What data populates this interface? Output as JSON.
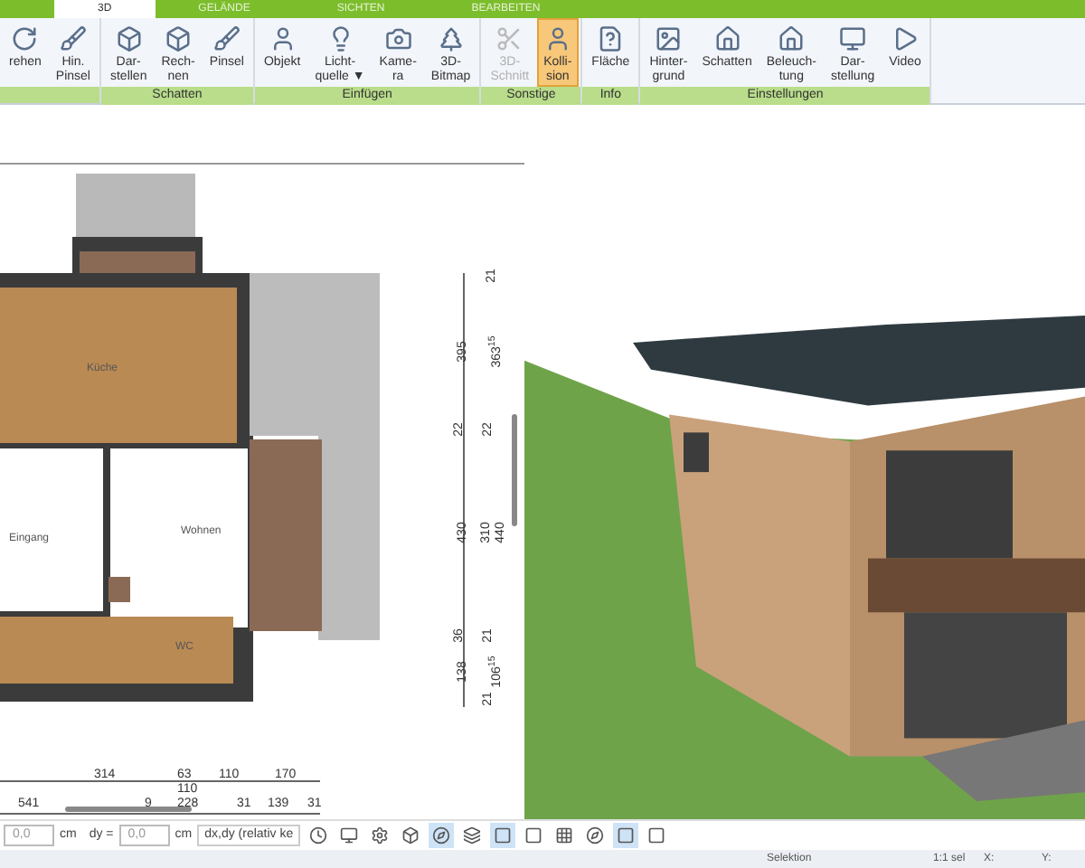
{
  "ribbon_tabs": [
    {
      "label": "3D",
      "selected": true
    },
    {
      "label": "GELÄNDE",
      "selected": false
    },
    {
      "label": "SICHTEN",
      "selected": false
    },
    {
      "label": "BEARBEITEN",
      "selected": false
    }
  ],
  "ribbon_groups": [
    {
      "buttons": [
        {
          "label": "rehen",
          "selected": false,
          "disabled": false
        },
        {
          "label": "Hin.\nPinsel",
          "selected": false,
          "disabled": false
        }
      ]
    },
    {
      "label": "Schatten",
      "buttons": [
        {
          "label": "Dar-\nstellen",
          "selected": false,
          "disabled": false
        },
        {
          "label": "Rech-\nnen",
          "selected": false,
          "disabled": false
        },
        {
          "label": "Pinsel",
          "selected": false,
          "disabled": false
        }
      ]
    },
    {
      "label": "Einfügen",
      "buttons": [
        {
          "label": "Objekt",
          "selected": false,
          "disabled": false
        },
        {
          "label": "Licht-\nquelle ▼",
          "selected": false,
          "disabled": false
        },
        {
          "label": "Kame-\nra",
          "selected": false,
          "disabled": false
        },
        {
          "label": "3D-\nBitmap",
          "selected": false,
          "disabled": false
        }
      ]
    },
    {
      "label": "Sonstige",
      "buttons": [
        {
          "label": "3D-\nSchnitt",
          "selected": false,
          "disabled": true
        },
        {
          "label": "Kolli-\nsion",
          "selected": true,
          "disabled": false
        }
      ]
    },
    {
      "label": "Info",
      "buttons": [
        {
          "label": "Fläche",
          "selected": false,
          "disabled": false
        }
      ]
    },
    {
      "label": "Einstellungen",
      "buttons": [
        {
          "label": "Hinter-\ngrund",
          "selected": false,
          "disabled": false
        },
        {
          "label": "Schatten",
          "selected": false,
          "disabled": false
        },
        {
          "label": "Beleuch-\ntung",
          "selected": false,
          "disabled": false
        },
        {
          "label": "Dar-\nstellung",
          "selected": false,
          "disabled": false
        },
        {
          "label": "Video",
          "selected": false,
          "disabled": false
        }
      ]
    }
  ],
  "floor_plan": {
    "rooms": [
      "Küche",
      "Eingang",
      "Wohnen",
      "WC"
    ],
    "vertical_dimensions": [
      "21",
      "395",
      "363$^{15}$",
      "22",
      "22",
      "430",
      "310",
      "440",
      "36",
      "21",
      "138",
      "106$^{15}$",
      "21"
    ],
    "horizontal_dimensions": [
      "314",
      "63",
      "110",
      "170",
      "110",
      "541",
      "9",
      "228",
      "31",
      "139",
      "31"
    ]
  },
  "toolbar": {
    "dx_value": "0,0",
    "dx_unit": "cm",
    "dy_label": "dy =",
    "dy_value": "0,0",
    "dy_unit": "cm",
    "mode": "dx,dy (relativ ke",
    "tool_states": [
      false,
      false,
      false,
      false,
      true,
      false,
      true,
      false,
      false,
      false,
      true,
      false
    ]
  },
  "status_bar": {
    "mode": "Selektion",
    "scale": "1:1 sel",
    "x_label": "X:",
    "y_label": "Y:"
  }
}
